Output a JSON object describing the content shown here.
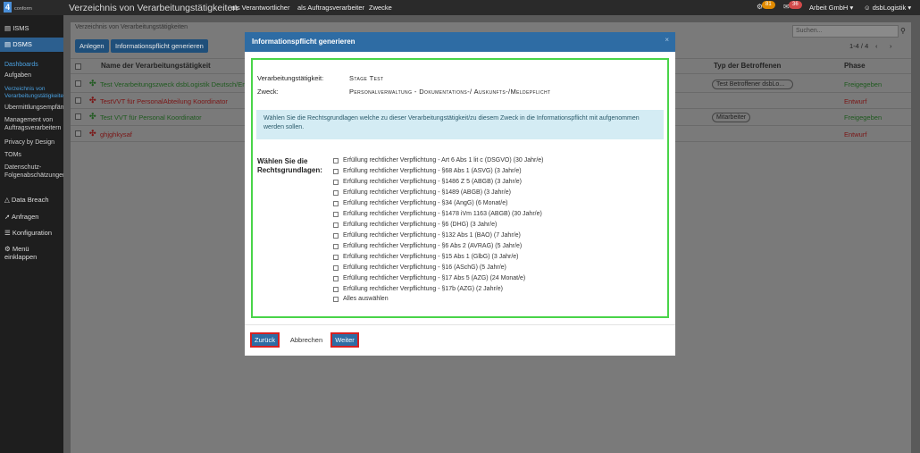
{
  "topbar": {
    "logo_mark": "4",
    "logo_text": "conform",
    "title": "Verzeichnis von Verarbeitungstätigkeiten",
    "nav": [
      "als Verantwortlicher",
      "als Auftragsverarbeiter",
      "Zwecke"
    ],
    "badge_1": "81",
    "badge_2": "36",
    "company": "Arbeit GmbH",
    "user": "dsbLogistik"
  },
  "sidebar": {
    "isms": "ISMS",
    "dsms": "DSMS",
    "sub": [
      "Dashboards",
      "Aufgaben",
      "Verzeichnis von",
      "Verarbeitungstätigkeiten",
      "Übermittlungsempfänger",
      "Management von",
      "Auftragsverarbeitern",
      "Privacy by Design",
      "TOMs",
      "Datenschutz-",
      "Folgenabschätzungen"
    ],
    "data_breach": "Data Breach",
    "anfragen": "Anfragen",
    "konfiguration": "Konfiguration",
    "menu_1": "Menü",
    "menu_2": "einklappen"
  },
  "panel": {
    "title": "Verzeichnis von Verarbeitungstätigkeiten",
    "btn_anlegen": "Anlegen",
    "btn_info": "Informationspflicht generieren",
    "search_placeholder": "Suchen...",
    "pager": "1-4 / 4",
    "col_name": "Name der Verarbeitungstätigkeit",
    "col_typ": "Typ der Betroffenen",
    "col_phase": "Phase",
    "rows": [
      {
        "name": "Test Verarbeitungszweck dsbLogistik Deutsch/Englisch",
        "tag": "Test Betroffener dsbLo...",
        "phase": "Freigegeben"
      },
      {
        "name": "TestVVT für PersonalAbteilung Koordinator",
        "tag": "",
        "phase": "Entwurf"
      },
      {
        "name": "Test VVT für Personal Koordinator",
        "tag": "Mitarbeiter",
        "phase": "Freigegeben"
      },
      {
        "name": "ghjghkysaf",
        "tag": "",
        "phase": "Entwurf"
      }
    ]
  },
  "modal": {
    "title": "Informationspflicht generieren",
    "close": "×",
    "lbl_vt": "Verarbeitungstätigkeit:",
    "val_vt": "Stage Test",
    "lbl_zweck": "Zweck:",
    "val_zweck": "Personalverwaltung - Dokumentations-/ Auskunfts-/Meldepflicht",
    "info": "Wählen Sie die Rechtsgrundlagen welche zu dieser Verarbeitungstätigkeit/zu diesem Zweck in die Informationspflicht mit aufgenommen werden sollen.",
    "wl_1": "Wählen Sie die",
    "wl_2": "Rechtsgrundlagen:",
    "options": [
      "Erfüllung rechtlicher Verpflichtung - Art 6 Abs 1 lit c (DSGVO) (30 Jahr/e)",
      "Erfüllung rechtlicher Verpflichtung - §68 Abs 1 (ASVG) (3 Jahr/e)",
      "Erfüllung rechtlicher Verpflichtung - §1486 Z 5 (ABGB) (3 Jahr/e)",
      "Erfüllung rechtlicher Verpflichtung - §1489 (ABGB) (3 Jahr/e)",
      "Erfüllung rechtlicher Verpflichtung - §34 (AngG) (6 Monat/e)",
      "Erfüllung rechtlicher Verpflichtung - §1478 iVm 1163 (ABGB) (30 Jahr/e)",
      "Erfüllung rechtlicher Verpflichtung - §6 (DHG) (3 Jahr/e)",
      "Erfüllung rechtlicher Verpflichtung - §132 Abs 1 (BAO) (7 Jahr/e)",
      "Erfüllung rechtlicher Verpflichtung - §6 Abs 2 (AVRAG) (5 Jahr/e)",
      "Erfüllung rechtlicher Verpflichtung - §15 Abs 1 (GlbG) (3 Jahr/e)",
      "Erfüllung rechtlicher Verpflichtung - §16 (ASchG) (5 Jahr/e)",
      "Erfüllung rechtlicher Verpflichtung - §17 Abs 5 (AZG) (24 Monat/e)",
      "Erfüllung rechtlicher Verpflichtung - §17b (AZG) (2 Jahr/e)",
      "Alles auswählen"
    ],
    "btn_back": "Zurück",
    "btn_cancel": "Abbrechen",
    "btn_next": "Weiter"
  }
}
